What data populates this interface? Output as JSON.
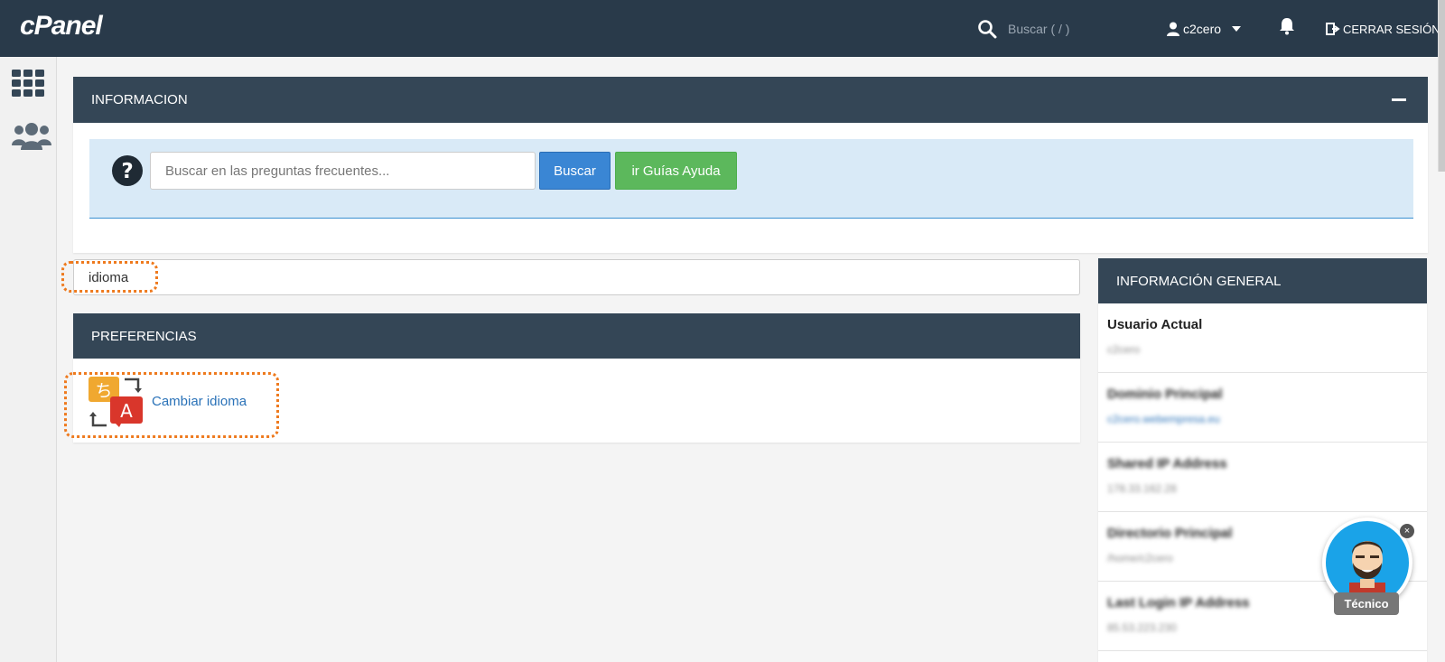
{
  "topbar": {
    "logo": "cPanel",
    "search_placeholder": "Buscar ( / )",
    "username": "c2cero",
    "logout_label": "CERRAR SESIÓN"
  },
  "info_panel": {
    "title": "INFORMACION",
    "faq_placeholder": "Buscar en las preguntas frecuentes...",
    "search_button": "Buscar",
    "guides_button": "ir Guías Ayuda"
  },
  "filter": {
    "value": "idioma"
  },
  "preferences": {
    "title": "PREFERENCIAS",
    "items": [
      {
        "label": "Cambiar idioma",
        "icon": "change-language-icon"
      }
    ]
  },
  "general_info": {
    "title": "INFORMACIÓN GENERAL",
    "rows": [
      {
        "label": "Usuario Actual",
        "value": "c2cero"
      },
      {
        "label": "Dominio Principal",
        "value": "c2cero.webempresa.eu"
      },
      {
        "label": "Shared IP Address",
        "value": "178.33.162.28"
      },
      {
        "label": "Directorio Principal",
        "value": "/home/c2cero"
      },
      {
        "label": "Last Login IP Address",
        "value": "85.53.223.230"
      }
    ]
  },
  "assistant": {
    "label": "Técnico",
    "close": "×"
  },
  "colors": {
    "topbar": "#293a4a",
    "panel_header": "#344656",
    "highlight": "#ee7a1e",
    "primary_button": "#3a86d4",
    "success_button": "#5cb85c"
  }
}
